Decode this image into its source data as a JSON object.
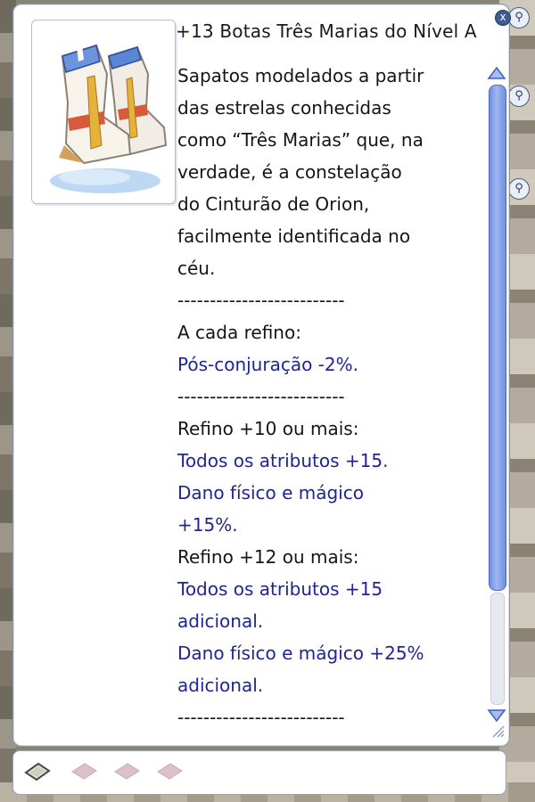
{
  "window": {
    "title": "+13 Botas Três Marias do Nível A",
    "close_label": "x"
  },
  "description": {
    "lines": [
      {
        "text": "Sapatos modelados a partir",
        "color": "#151515"
      },
      {
        "text": "das estrelas conhecidas",
        "color": "#151515"
      },
      {
        "text": "como “Três Marias” que, na",
        "color": "#151515"
      },
      {
        "text": "verdade, é a constelação",
        "color": "#151515"
      },
      {
        "text": "do Cinturão de Orion,",
        "color": "#151515"
      },
      {
        "text": "facilmente identificada no",
        "color": "#151515"
      },
      {
        "text": "céu.",
        "color": "#151515"
      },
      {
        "text": "--------------------------",
        "color": "#151515"
      },
      {
        "text": "A cada refino:",
        "color": "#151515"
      },
      {
        "text": "Pós-conjuração -2%.",
        "color": "#1e249a"
      },
      {
        "text": "--------------------------",
        "color": "#151515"
      },
      {
        "text": "Refino +10 ou mais:",
        "color": "#151515"
      },
      {
        "text": "Todos os atributos +15.",
        "color": "#1e249a"
      },
      {
        "text": "Dano físico e mágico",
        "color": "#1e249a"
      },
      {
        "text": "+15%.",
        "color": "#1e249a"
      },
      {
        "text": "Refino +12 ou mais:",
        "color": "#151515"
      },
      {
        "text": "Todos os atributos +15",
        "color": "#1e249a"
      },
      {
        "text": "adicional.",
        "color": "#1e249a"
      },
      {
        "text": "Dano físico e mágico +25%",
        "color": "#1e249a"
      },
      {
        "text": "adicional.",
        "color": "#1e249a"
      },
      {
        "text": "--------------------------",
        "color": "#151515"
      }
    ]
  },
  "item_image": {
    "icon": "boots-icon"
  },
  "scrollbar": {
    "position": 0.0
  },
  "card_slots": {
    "icons": [
      "card-icon",
      "empty-slot-icon",
      "empty-slot-icon",
      "empty-slot-icon"
    ]
  },
  "colors": {
    "effect_text": "#1e249a",
    "normal_text": "#151515",
    "scroll_thumb": "#7f9be6"
  }
}
